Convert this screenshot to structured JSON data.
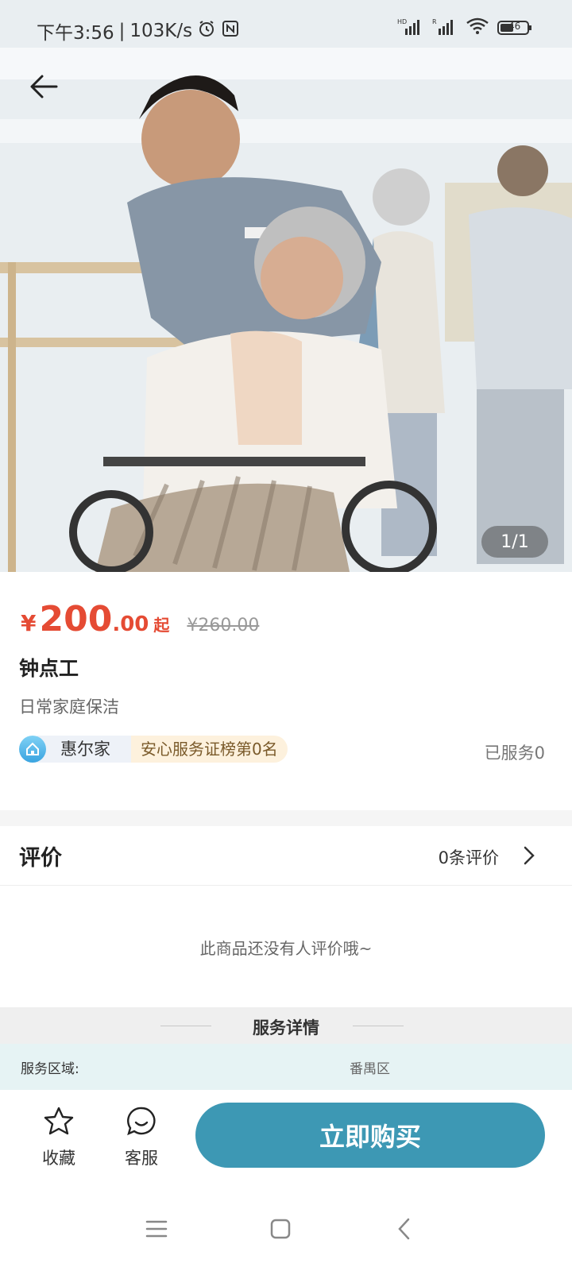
{
  "status_bar": {
    "time": "下午3:56",
    "separator": "|",
    "net_speed": "103K/s",
    "icons": [
      "alarm-icon",
      "nfc-icon",
      "hd-signal-icon",
      "r-signal-icon",
      "wifi-icon",
      "battery-icon"
    ],
    "battery": "46"
  },
  "hero": {
    "image_counter": "1/1",
    "description": ""
  },
  "product": {
    "currency": "¥",
    "price_int": "200",
    "price_dec": ".00",
    "price_suffix": "起",
    "original_price": "¥260.00",
    "title": "钟点工",
    "subtitle": "日常家庭保洁",
    "shop_name": "惠尔家",
    "shop_badge": "安心服务证榜第0名",
    "served": "已服务0"
  },
  "reviews": {
    "title": "评价",
    "count_text": "0条评价",
    "empty_text": "此商品还没有人评价哦~"
  },
  "service_details": {
    "title": "服务详情",
    "rows": [
      {
        "label": "服务区域:",
        "value": "番禺区"
      }
    ]
  },
  "action_bar": {
    "favorite_label": "收藏",
    "service_label": "客服",
    "buy_label": "立即购买"
  },
  "colors": {
    "price": "#e54b34",
    "buy_button": "#3d98b4",
    "detail_row_bg": "#e6f3f4"
  }
}
